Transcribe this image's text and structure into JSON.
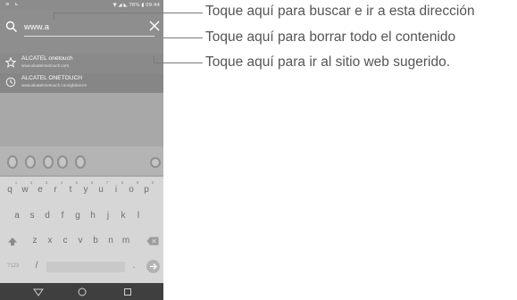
{
  "status_bar": {
    "left_icons": "≡ ⊾",
    "right_text": "▼ ◢ ◣ 76% ▮ 09:44"
  },
  "search": {
    "value": "www.a",
    "icon": "search-icon",
    "clear_icon": "close-icon"
  },
  "suggestions": [
    {
      "icon": "star-icon",
      "title": "ALCATEL onetouch",
      "url": "www.alcatelonetouch.com"
    },
    {
      "icon": "history-icon",
      "title": "ALCATEL ONETOUCH",
      "url": "www.alcatelonetouch.com/global-en"
    }
  ],
  "keyboard": {
    "row1": [
      "q",
      "w",
      "e",
      "r",
      "t",
      "y",
      "u",
      "i",
      "o",
      "p"
    ],
    "row1_hints": [
      "1",
      "2",
      "3",
      "4",
      "5",
      "6",
      "7",
      "8",
      "9",
      "0"
    ],
    "row2": [
      "a",
      "s",
      "d",
      "f",
      "g",
      "h",
      "j",
      "k",
      "l"
    ],
    "row3": [
      "z",
      "x",
      "c",
      "v",
      "b",
      "n",
      "m"
    ],
    "symbols_label": "?123",
    "slash_label": "/",
    "dot_label": "."
  },
  "nav": {
    "back_icon": "back-triangle-icon",
    "home_icon": "home-circle-icon",
    "recents_icon": "recents-square-icon"
  },
  "callouts": [
    "Toque aquí para buscar e ir a esta dirección",
    "Toque aquí para borrar todo el contenido",
    "Toque aquí para ir al sitio web sugerido."
  ],
  "colors": {
    "screen_overlay": "#9a9a9a",
    "keyboard_bg": "#d6d6d6",
    "navbar_bg": "#3f3f3f",
    "callout_text": "#555555"
  }
}
